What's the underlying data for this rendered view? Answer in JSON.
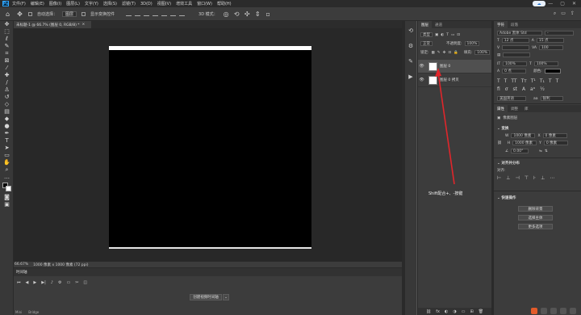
{
  "menubar": {
    "logo": "Ps",
    "items": [
      "文件(F)",
      "编辑(E)",
      "图像(I)",
      "图层(L)",
      "文字(Y)",
      "选择(S)",
      "滤镜(T)",
      "3D(D)",
      "视图(V)",
      "增效工具",
      "窗口(W)",
      "帮助(H)"
    ],
    "cloud": "☁",
    "minimize": "—",
    "maximize": "▢",
    "close": "✕"
  },
  "options": {
    "home_icon": "⌂",
    "move_icon": "✥",
    "auto_select_label": "自动选择：",
    "auto_select_value": "图层",
    "show_transform_label": "显示变换控件",
    "mode_3d_label": "3D 模式：",
    "search_icon": "⌕",
    "workspace_icon": "▭",
    "share_icon": "⇪"
  },
  "document": {
    "tab_title": "未标题-1 @ 66.7% (图层 0, RGB/8) *",
    "tab_close": "×"
  },
  "status": {
    "zoom": "66.67%",
    "doc_info": "1000 像素 x 1000 像素 (72 ppi)"
  },
  "timeline": {
    "title": "时间轴",
    "create_button": "创建视频时间轴",
    "dropdown": "⌄",
    "ctrls": [
      "⏮",
      "◀",
      "▶",
      "▶|",
      "♪",
      "⚙",
      "▭",
      "✂",
      "◫"
    ],
    "footer": [
      "Mini",
      "Bridge"
    ]
  },
  "layers_panel": {
    "tabs": [
      "图层",
      "通道"
    ],
    "filter_label": "类型",
    "blend_mode": "正常",
    "opacity_label": "不透明度:",
    "opacity_value": "100%",
    "lock_label": "锁定:",
    "fill_label": "填充:",
    "fill_value": "100%",
    "layers": [
      {
        "name": "图层 0",
        "selected": true
      },
      {
        "name": "图层 0 拷贝",
        "selected": false
      }
    ],
    "footer_icons": [
      "⛓",
      "fx",
      "◐",
      "◑",
      "▭",
      "⊞",
      "🗑"
    ]
  },
  "annotation": {
    "text": "Shift配合+、-按键",
    "color": "#e0262b"
  },
  "right_panel": {
    "char_tabs": [
      "字符",
      "段落"
    ],
    "font_name": "Adobe 黑体 Std",
    "font_style": "-",
    "font_size": "12 点",
    "leading": "15 点",
    "tracking": "100",
    "scale_v": "100%",
    "scale_h": "100%",
    "baseline": "0 点",
    "color_label": "颜色:",
    "language": "美国英语",
    "aa": "锐利",
    "props_tabs": [
      "属性",
      "调整",
      "库"
    ],
    "pixel_layer": "像素图层",
    "transform_title": "变换",
    "w_label": "W",
    "w_value": "1000 像素",
    "h_label": "H",
    "h_value": "1000 像素",
    "x_label": "X",
    "x_value": "0 像素",
    "y_label": "Y",
    "y_value": "0 像素",
    "angle": "0.00°",
    "align_title": "对齐并分布",
    "align_label": "对齐:",
    "quick_title": "快速操作",
    "btn_remove_bg": "删除背景",
    "btn_select_subject": "选择主体",
    "btn_more": "更多选项"
  },
  "accent_colors": {
    "ps_blue": "#31a8ff",
    "canvas_bg": "#282828",
    "panel_bg": "#3c3c3c"
  }
}
